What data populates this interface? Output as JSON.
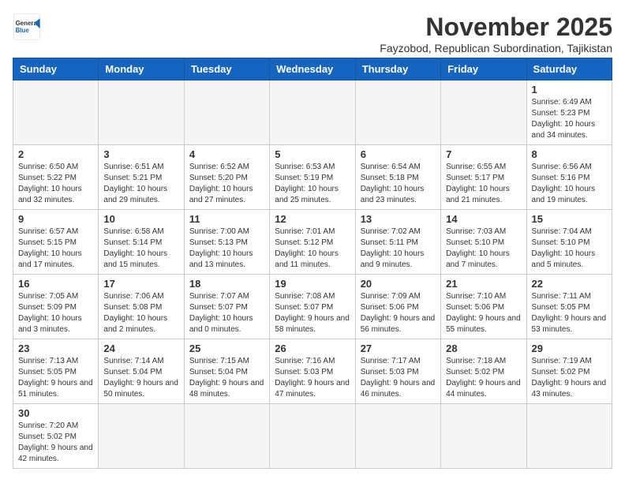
{
  "header": {
    "logo_general": "General",
    "logo_blue": "Blue",
    "month_title": "November 2025",
    "subtitle": "Fayzobod, Republican Subordination, Tajikistan"
  },
  "weekdays": [
    "Sunday",
    "Monday",
    "Tuesday",
    "Wednesday",
    "Thursday",
    "Friday",
    "Saturday"
  ],
  "weeks": [
    [
      {
        "day": "",
        "info": ""
      },
      {
        "day": "",
        "info": ""
      },
      {
        "day": "",
        "info": ""
      },
      {
        "day": "",
        "info": ""
      },
      {
        "day": "",
        "info": ""
      },
      {
        "day": "",
        "info": ""
      },
      {
        "day": "1",
        "info": "Sunrise: 6:49 AM\nSunset: 5:23 PM\nDaylight: 10 hours\nand 34 minutes."
      }
    ],
    [
      {
        "day": "2",
        "info": "Sunrise: 6:50 AM\nSunset: 5:22 PM\nDaylight: 10 hours\nand 32 minutes."
      },
      {
        "day": "3",
        "info": "Sunrise: 6:51 AM\nSunset: 5:21 PM\nDaylight: 10 hours\nand 29 minutes."
      },
      {
        "day": "4",
        "info": "Sunrise: 6:52 AM\nSunset: 5:20 PM\nDaylight: 10 hours\nand 27 minutes."
      },
      {
        "day": "5",
        "info": "Sunrise: 6:53 AM\nSunset: 5:19 PM\nDaylight: 10 hours\nand 25 minutes."
      },
      {
        "day": "6",
        "info": "Sunrise: 6:54 AM\nSunset: 5:18 PM\nDaylight: 10 hours\nand 23 minutes."
      },
      {
        "day": "7",
        "info": "Sunrise: 6:55 AM\nSunset: 5:17 PM\nDaylight: 10 hours\nand 21 minutes."
      },
      {
        "day": "8",
        "info": "Sunrise: 6:56 AM\nSunset: 5:16 PM\nDaylight: 10 hours\nand 19 minutes."
      }
    ],
    [
      {
        "day": "9",
        "info": "Sunrise: 6:57 AM\nSunset: 5:15 PM\nDaylight: 10 hours\nand 17 minutes."
      },
      {
        "day": "10",
        "info": "Sunrise: 6:58 AM\nSunset: 5:14 PM\nDaylight: 10 hours\nand 15 minutes."
      },
      {
        "day": "11",
        "info": "Sunrise: 7:00 AM\nSunset: 5:13 PM\nDaylight: 10 hours\nand 13 minutes."
      },
      {
        "day": "12",
        "info": "Sunrise: 7:01 AM\nSunset: 5:12 PM\nDaylight: 10 hours\nand 11 minutes."
      },
      {
        "day": "13",
        "info": "Sunrise: 7:02 AM\nSunset: 5:11 PM\nDaylight: 10 hours\nand 9 minutes."
      },
      {
        "day": "14",
        "info": "Sunrise: 7:03 AM\nSunset: 5:10 PM\nDaylight: 10 hours\nand 7 minutes."
      },
      {
        "day": "15",
        "info": "Sunrise: 7:04 AM\nSunset: 5:10 PM\nDaylight: 10 hours\nand 5 minutes."
      }
    ],
    [
      {
        "day": "16",
        "info": "Sunrise: 7:05 AM\nSunset: 5:09 PM\nDaylight: 10 hours\nand 3 minutes."
      },
      {
        "day": "17",
        "info": "Sunrise: 7:06 AM\nSunset: 5:08 PM\nDaylight: 10 hours\nand 2 minutes."
      },
      {
        "day": "18",
        "info": "Sunrise: 7:07 AM\nSunset: 5:07 PM\nDaylight: 10 hours\nand 0 minutes."
      },
      {
        "day": "19",
        "info": "Sunrise: 7:08 AM\nSunset: 5:07 PM\nDaylight: 9 hours\nand 58 minutes."
      },
      {
        "day": "20",
        "info": "Sunrise: 7:09 AM\nSunset: 5:06 PM\nDaylight: 9 hours\nand 56 minutes."
      },
      {
        "day": "21",
        "info": "Sunrise: 7:10 AM\nSunset: 5:06 PM\nDaylight: 9 hours\nand 55 minutes."
      },
      {
        "day": "22",
        "info": "Sunrise: 7:11 AM\nSunset: 5:05 PM\nDaylight: 9 hours\nand 53 minutes."
      }
    ],
    [
      {
        "day": "23",
        "info": "Sunrise: 7:13 AM\nSunset: 5:05 PM\nDaylight: 9 hours\nand 51 minutes."
      },
      {
        "day": "24",
        "info": "Sunrise: 7:14 AM\nSunset: 5:04 PM\nDaylight: 9 hours\nand 50 minutes."
      },
      {
        "day": "25",
        "info": "Sunrise: 7:15 AM\nSunset: 5:04 PM\nDaylight: 9 hours\nand 48 minutes."
      },
      {
        "day": "26",
        "info": "Sunrise: 7:16 AM\nSunset: 5:03 PM\nDaylight: 9 hours\nand 47 minutes."
      },
      {
        "day": "27",
        "info": "Sunrise: 7:17 AM\nSunset: 5:03 PM\nDaylight: 9 hours\nand 46 minutes."
      },
      {
        "day": "28",
        "info": "Sunrise: 7:18 AM\nSunset: 5:02 PM\nDaylight: 9 hours\nand 44 minutes."
      },
      {
        "day": "29",
        "info": "Sunrise: 7:19 AM\nSunset: 5:02 PM\nDaylight: 9 hours\nand 43 minutes."
      }
    ],
    [
      {
        "day": "30",
        "info": "Sunrise: 7:20 AM\nSunset: 5:02 PM\nDaylight: 9 hours\nand 42 minutes."
      },
      {
        "day": "",
        "info": ""
      },
      {
        "day": "",
        "info": ""
      },
      {
        "day": "",
        "info": ""
      },
      {
        "day": "",
        "info": ""
      },
      {
        "day": "",
        "info": ""
      },
      {
        "day": "",
        "info": ""
      }
    ]
  ]
}
